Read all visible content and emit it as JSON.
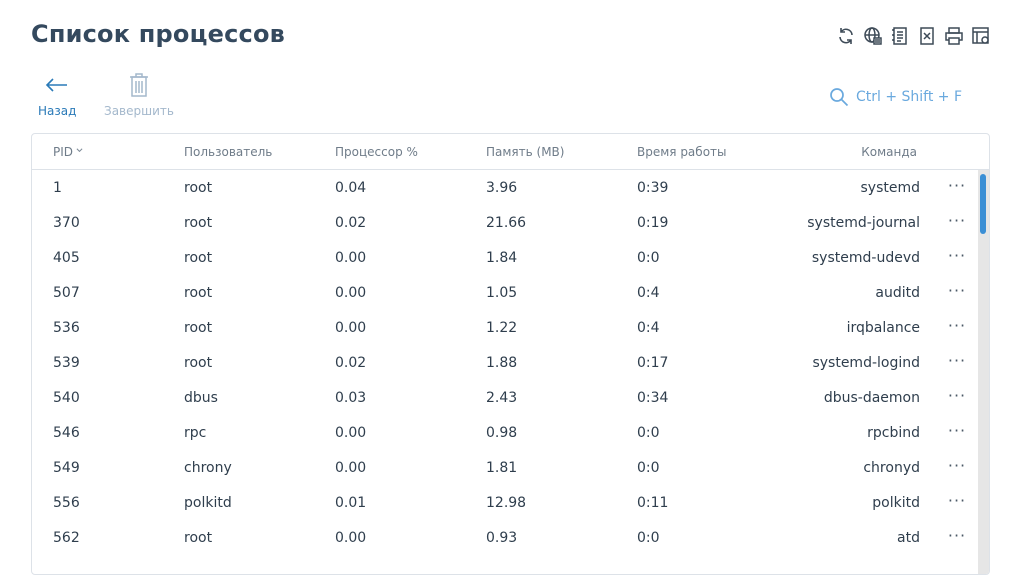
{
  "page": {
    "title": "Список процессов"
  },
  "top_icons": [
    "refresh-icon",
    "network-icon",
    "document-list-icon",
    "excel-export-icon",
    "print-icon",
    "settings-table-icon"
  ],
  "toolbar": {
    "back_label": "Назад",
    "end_label": "Завершить"
  },
  "search": {
    "hint": "Ctrl + Shift + F"
  },
  "table": {
    "headers": {
      "pid": "PID",
      "user": "Пользователь",
      "cpu": "Процессор %",
      "mem": "Память (MB)",
      "time": "Время работы",
      "command": "Команда"
    },
    "rows": [
      {
        "pid": "1",
        "user": "root",
        "cpu": "0.04",
        "mem": "3.96",
        "time": "0:39",
        "command": "systemd"
      },
      {
        "pid": "370",
        "user": "root",
        "cpu": "0.02",
        "mem": "21.66",
        "time": "0:19",
        "command": "systemd-journal"
      },
      {
        "pid": "405",
        "user": "root",
        "cpu": "0.00",
        "mem": "1.84",
        "time": "0:0",
        "command": "systemd-udevd"
      },
      {
        "pid": "507",
        "user": "root",
        "cpu": "0.00",
        "mem": "1.05",
        "time": "0:4",
        "command": "auditd"
      },
      {
        "pid": "536",
        "user": "root",
        "cpu": "0.00",
        "mem": "1.22",
        "time": "0:4",
        "command": "irqbalance"
      },
      {
        "pid": "539",
        "user": "root",
        "cpu": "0.02",
        "mem": "1.88",
        "time": "0:17",
        "command": "systemd-logind"
      },
      {
        "pid": "540",
        "user": "dbus",
        "cpu": "0.03",
        "mem": "2.43",
        "time": "0:34",
        "command": "dbus-daemon"
      },
      {
        "pid": "546",
        "user": "rpc",
        "cpu": "0.00",
        "mem": "0.98",
        "time": "0:0",
        "command": "rpcbind"
      },
      {
        "pid": "549",
        "user": "chrony",
        "cpu": "0.00",
        "mem": "1.81",
        "time": "0:0",
        "command": "chronyd"
      },
      {
        "pid": "556",
        "user": "polkitd",
        "cpu": "0.01",
        "mem": "12.98",
        "time": "0:11",
        "command": "polkitd"
      },
      {
        "pid": "562",
        "user": "root",
        "cpu": "0.00",
        "mem": "0.93",
        "time": "0:0",
        "command": "atd"
      }
    ],
    "more_label": "···"
  }
}
